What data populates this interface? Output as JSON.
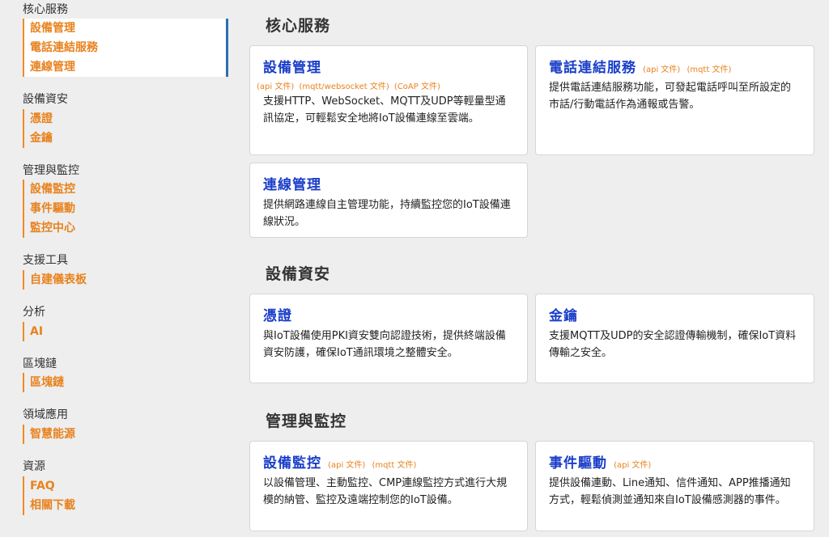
{
  "sidebar": {
    "groups": [
      {
        "title": "核心服務",
        "items": [
          "設備管理",
          "電話連結服務",
          "連線管理"
        ]
      },
      {
        "title": "設備資安",
        "items": [
          "憑證",
          "金鑰"
        ]
      },
      {
        "title": "管理與監控",
        "items": [
          "設備監控",
          "事件驅動",
          "監控中心"
        ]
      },
      {
        "title": "支援工具",
        "items": [
          "自建儀表板"
        ]
      },
      {
        "title": "分析",
        "items": [
          "AI"
        ]
      },
      {
        "title": "區塊鏈",
        "items": [
          "區塊鏈"
        ]
      },
      {
        "title": "領域應用",
        "items": [
          "智慧能源"
        ]
      },
      {
        "title": "資源",
        "items": [
          "FAQ",
          "相關下載"
        ]
      }
    ]
  },
  "main": {
    "sections": [
      {
        "title": "核心服務",
        "cards": [
          {
            "title": "設備管理",
            "docs": [
              "(api 文件)",
              "(mqtt/websocket 文件)",
              "(CoAP 文件)"
            ],
            "desc": "支援HTTP、WebSocket、MQTT及UDP等輕量型通訊協定，可輕鬆安全地將IoT設備連線至雲端。"
          },
          {
            "title": "電話連結服務",
            "docs": [
              "(api 文件)",
              "(mqtt 文件)"
            ],
            "desc": "提供電話連結服務功能，可發起電話呼叫至所設定的市話/行動電話作為通報或告警。"
          },
          {
            "title": "連線管理",
            "docs": [],
            "desc": "提供網路連線自主管理功能，持續監控您的IoT設備連線狀況。"
          }
        ]
      },
      {
        "title": "設備資安",
        "cards": [
          {
            "title": "憑證",
            "docs": [],
            "desc": "與IoT設備使用PKI資安雙向認證技術，提供終端設備資安防護，確保IoT通訊環境之整體安全。"
          },
          {
            "title": "金鑰",
            "docs": [],
            "desc": "支援MQTT及UDP的安全認證傳輸機制，確保IoT資料傳輸之安全。"
          }
        ]
      },
      {
        "title": "管理與監控",
        "cards": [
          {
            "title": "設備監控",
            "docs": [
              "(api 文件)",
              "(mqtt 文件)"
            ],
            "desc": "以設備管理、主動監控、CMP連線監控方式進行大規模的納管、監控及遠端控制您的IoT設備。"
          },
          {
            "title": "事件驅動",
            "docs": [
              "(api 文件)"
            ],
            "desc": "提供設備連動、Line通知、信件通知、APP推播通知方式，輕鬆偵測並通知來自IoT設備感測器的事件。"
          }
        ]
      }
    ]
  },
  "colors": {
    "accent_orange": "#e8821e",
    "link_blue": "#1a3ec8",
    "active_bar": "#2e6db4"
  }
}
